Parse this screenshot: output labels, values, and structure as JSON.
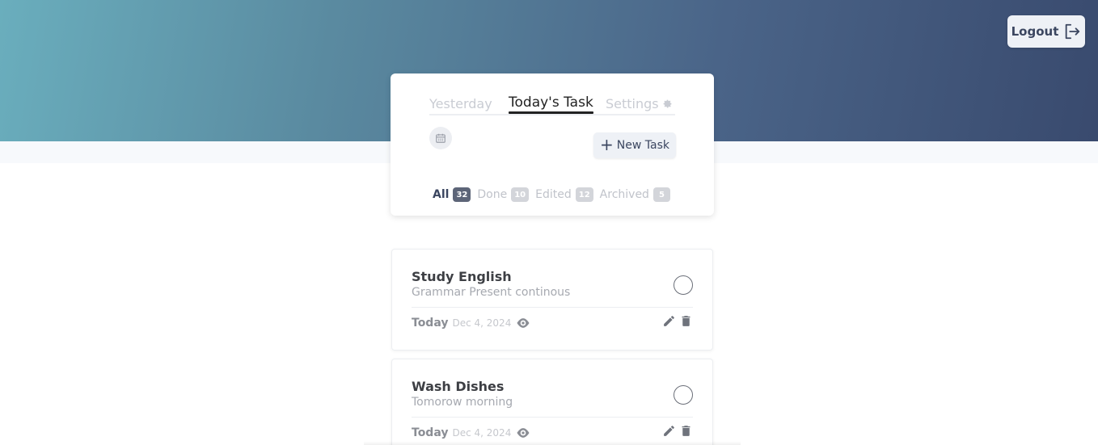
{
  "header": {
    "logout_label": "Logout",
    "gradient_start": "#6aaebd",
    "gradient_end": "#394a6e"
  },
  "tabs": [
    {
      "label": "Yesterday",
      "active": false
    },
    {
      "label": "Today's Task",
      "active": true
    },
    {
      "label": "Settings",
      "active": false,
      "icon": "gear-icon"
    }
  ],
  "toolbar": {
    "calendar_icon": "calendar-icon",
    "new_task_label": "New Task"
  },
  "filters": [
    {
      "label": "All",
      "count": "32",
      "active": true
    },
    {
      "label": "Done",
      "count": "10",
      "active": false
    },
    {
      "label": "Edited",
      "count": "12",
      "active": false
    },
    {
      "label": "Archived",
      "count": "5",
      "active": false
    }
  ],
  "tasks": [
    {
      "title": "Study English",
      "description": "Grammar Present continous",
      "day": "Today",
      "date": "Dec 4, 2024"
    },
    {
      "title": "Wash Dishes",
      "description": "Tomorow morning",
      "day": "Today",
      "date": "Dec 4, 2024"
    }
  ]
}
